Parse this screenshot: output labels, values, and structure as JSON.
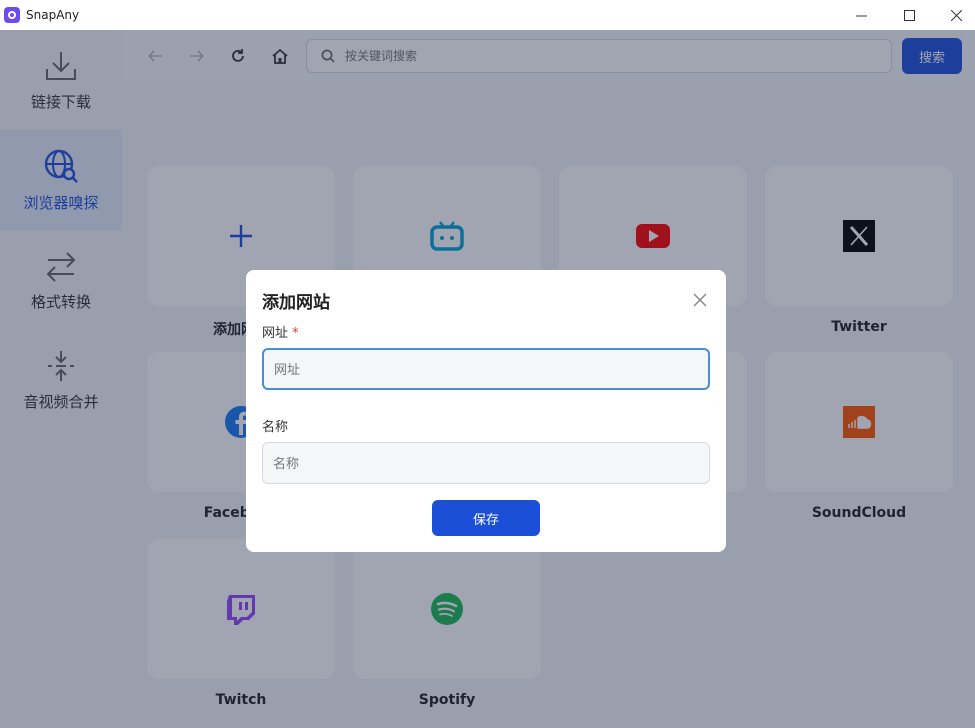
{
  "app": {
    "title": "SnapAny"
  },
  "sidebar": {
    "items": [
      {
        "label": "链接下载",
        "icon": "download-icon"
      },
      {
        "label": "浏览器嗅探",
        "icon": "globe-search-icon"
      },
      {
        "label": "格式转换",
        "icon": "convert-arrows-icon"
      },
      {
        "label": "音视频合并",
        "icon": "merge-icon"
      }
    ],
    "active_index": 1,
    "accent": "#1d4ed8"
  },
  "toolbar": {
    "search_placeholder": "按关键词搜索",
    "search_button": "搜索"
  },
  "sites": [
    {
      "label": "添加网站",
      "icon": "plus-icon"
    },
    {
      "label": "",
      "icon": "bilibili-icon"
    },
    {
      "label": "",
      "icon": "youtube-icon"
    },
    {
      "label": "Twitter",
      "icon": "x-icon"
    },
    {
      "label": "Facebook",
      "icon": "facebook-icon"
    },
    {
      "label": "",
      "icon": "blank"
    },
    {
      "label": "",
      "icon": "blank"
    },
    {
      "label": "SoundCloud",
      "icon": "soundcloud-icon"
    },
    {
      "label": "Twitch",
      "icon": "twitch-icon"
    },
    {
      "label": "Spotify",
      "icon": "spotify-icon"
    }
  ],
  "dialog": {
    "title": "添加网站",
    "url_label": "网址",
    "required_mark": "*",
    "url_placeholder": "网址",
    "name_label": "名称",
    "name_placeholder": "名称",
    "save_button": "保存"
  },
  "colors": {
    "primary": "#1c4fd8",
    "overlay": "rgba(30,40,70,0.42)"
  }
}
